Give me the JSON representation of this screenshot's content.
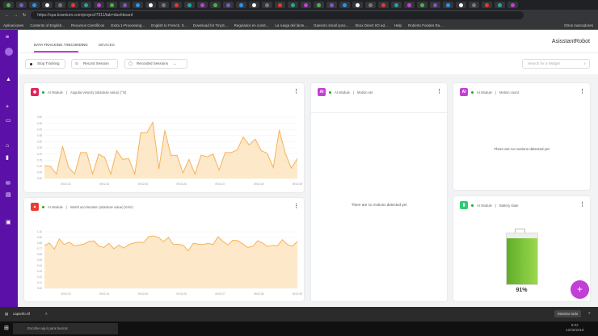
{
  "browser": {
    "url": "https://spa.bramium.com/project/7911/tab=dashboard",
    "bookmarks": [
      "Aplicaciones",
      "Contents of English...",
      "Recursos Científicos",
      "Extra 1-Processing...",
      "English to French, It...",
      "Download for TinyS...",
      "Regulador en const...",
      "La ruega del lácte...",
      "Gaercito small cpns...",
      "Xbox Direct I/O ad...",
      "Help",
      "Roberto Fondes Ra...",
      "Otros marcadores"
    ]
  },
  "header": {
    "app_name": "AsisstantRobot",
    "tabs": [
      {
        "label": "DATA TRACKING / RECORDING",
        "active": true
      },
      {
        "label": "DEVICES",
        "active": false
      }
    ]
  },
  "toolbar": {
    "stop_label": "Stop Tracking",
    "record_label": "Record Session",
    "recorded_label": "Recorded Sessions",
    "search_placeholder": "Search for a Widget"
  },
  "colors": {
    "accent": "#c23fd6",
    "sidebar": "#5b11a8",
    "line": "#f5b35b",
    "fill": "#fde4bf",
    "battery": "#6fc22f"
  },
  "widgets": {
    "w1": {
      "module": "AI Module",
      "title": "Angular velocity (absolute value) (°/s)",
      "icon": "camera-icon",
      "color": "#e0245e"
    },
    "w2": {
      "module": "AI Module",
      "title": "World acceleration (absolute value) (m/s²)",
      "icon": "robot-icon",
      "color": "#ee3b2f"
    },
    "w3": {
      "module": "AI Module",
      "title": "Motion set",
      "icon": "AI",
      "color": "#c23fd6",
      "empty": "There are no motions detected yet"
    },
    "w4": {
      "module": "AI Module",
      "title": "Motion count",
      "icon": "AI",
      "color": "#c23fd6",
      "empty": "There are no motions detected yet"
    },
    "w5": {
      "module": "AI Module",
      "title": "Battery state",
      "icon": "battery-icon",
      "color": "#2ecc71",
      "battery_percent": 91,
      "battery_label": "91%"
    }
  },
  "chart_data": [
    {
      "type": "area",
      "ylim": [
        0,
        0.5
      ],
      "yticks": [
        "0.00",
        "0.05",
        "0.10",
        "0.15",
        "0.20",
        "0.25",
        "0.30",
        "0.35",
        "0.40",
        "0.45",
        "0.50"
      ],
      "xticks": [
        "09:02:23",
        "09:02:24",
        "09:02:25",
        "09:02:26",
        "09:02:27",
        "09:02:28",
        "09:02:29"
      ],
      "values": [
        0.103,
        0.099,
        0.036,
        0.262,
        0.093,
        0.036,
        0.211,
        0.211,
        0.036,
        0.198,
        0.173,
        0.036,
        0.226,
        0.156,
        0.162,
        0.036,
        0.373,
        0.373,
        0.458,
        0.078,
        0.392,
        0.188,
        0.188,
        0.046,
        0.156,
        0.036,
        0.19,
        0.177,
        0.198,
        0.068,
        0.211,
        0.211,
        0.232,
        0.338,
        0.274,
        0.321,
        0.226,
        0.205,
        0.089,
        0.395,
        0.205,
        0.084,
        0.162
      ]
    },
    {
      "type": "area",
      "ylim": [
        0,
        1.1
      ],
      "yticks": [
        "0.00",
        "0.11",
        "0.22",
        "0.33",
        "0.44",
        "0.55",
        "0.66",
        "0.77",
        "0.88",
        "0.99",
        "1.10"
      ],
      "xticks": [
        "09:02:23",
        "09:02:24",
        "09:02:25",
        "09:02:26",
        "09:02:27",
        "09:02:28",
        "09:02:29"
      ],
      "values": [
        0.833,
        0.88,
        0.763,
        0.96,
        0.852,
        0.899,
        0.829,
        0.843,
        0.861,
        0.913,
        0.922,
        0.819,
        0.796,
        0.875,
        0.772,
        0.843,
        0.786,
        0.852,
        0.88,
        0.899,
        0.889,
        1.006,
        1.02,
        0.992,
        0.908,
        0.992,
        0.852,
        0.857,
        0.838,
        0.73,
        0.875,
        0.861,
        0.852,
        0.875,
        0.852,
        1.006,
        0.913,
        0.843,
        0.936,
        0.927,
        0.861,
        0.796,
        0.819,
        0.927,
        0.88,
        0.814,
        0.838,
        0.829,
        0.946,
        0.852,
        0.819,
        0.913
      ]
    }
  ],
  "taskbar": {
    "download": "capsnfo.rtf",
    "show_all": "Mostrar todo",
    "search": "Escribe aquí para buscar",
    "time": "9:02",
    "date": "12/06/2019"
  }
}
